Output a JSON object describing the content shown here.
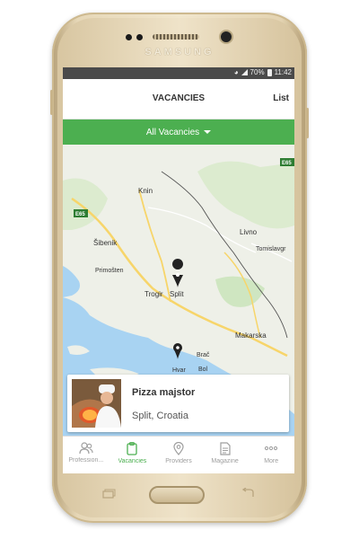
{
  "device": {
    "brand": "SAMSUNG"
  },
  "status_bar": {
    "battery": "70%",
    "time": "11:42"
  },
  "app_bar": {
    "title": "VACANCIES",
    "action": "List"
  },
  "filter": {
    "label": "All Vacancies"
  },
  "map": {
    "places": [
      "Knin",
      "Livno",
      "Tomislavgr",
      "Šibenik",
      "Primošten",
      "Trogir",
      "Split",
      "Makarska",
      "Brač",
      "Bol",
      "Hvar"
    ],
    "road_labels": [
      "E65",
      "E65"
    ],
    "colors": {
      "sea": "#a8d3f2",
      "land": "#eef0e8",
      "green": "#cfe6c1",
      "road": "#f7d56a"
    }
  },
  "vacancy_card": {
    "title": "Pizza majstor",
    "location": "Split, Croatia"
  },
  "bottom_nav": {
    "items": [
      {
        "label": "Profession...",
        "icon": "people-icon",
        "active": false
      },
      {
        "label": "Vacancies",
        "icon": "clipboard-icon",
        "active": true
      },
      {
        "label": "Providers",
        "icon": "location-pin-icon",
        "active": false
      },
      {
        "label": "Magazine",
        "icon": "document-icon",
        "active": false
      },
      {
        "label": "More",
        "icon": "more-dots-icon",
        "active": false
      }
    ]
  },
  "theme": {
    "accent": "#4caf50",
    "status_bar": "#4a4a4a"
  }
}
